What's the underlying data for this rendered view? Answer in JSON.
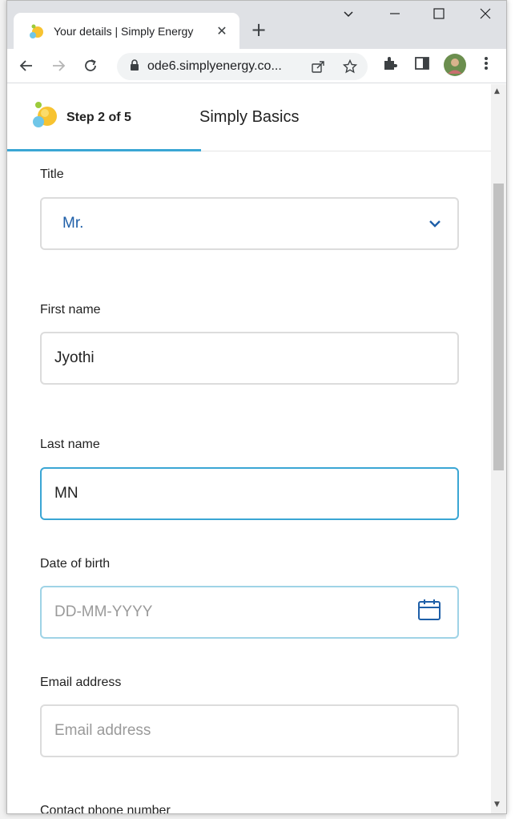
{
  "browser": {
    "tab_title": "Your details | Simply Energy",
    "url": "ode6.simplyenergy.co...",
    "new_tab_glyph": "+",
    "tab_close_glyph": "✕"
  },
  "form": {
    "step_label": "Step 2 of 5",
    "plan_name": "Simply Basics",
    "title": {
      "label": "Title",
      "value": "Mr."
    },
    "first_name": {
      "label": "First name",
      "value": "Jyothi"
    },
    "last_name": {
      "label": "Last name",
      "value": "MN"
    },
    "dob": {
      "label": "Date of birth",
      "placeholder": "DD-MM-YYYY"
    },
    "email": {
      "label": "Email address",
      "placeholder": "Email address"
    },
    "phone": {
      "label": "Contact phone number"
    }
  },
  "colors": {
    "accent": "#3aa6d4",
    "select_text": "#1e5fa8",
    "calendar_icon": "#1e5fa8"
  },
  "icons": [
    "back-icon",
    "forward-icon",
    "reload-icon",
    "lock-icon",
    "share-icon",
    "star-icon",
    "extensions-icon",
    "side-panel-icon",
    "avatar",
    "menu-icon",
    "chevron-down-icon",
    "calendar-icon"
  ]
}
